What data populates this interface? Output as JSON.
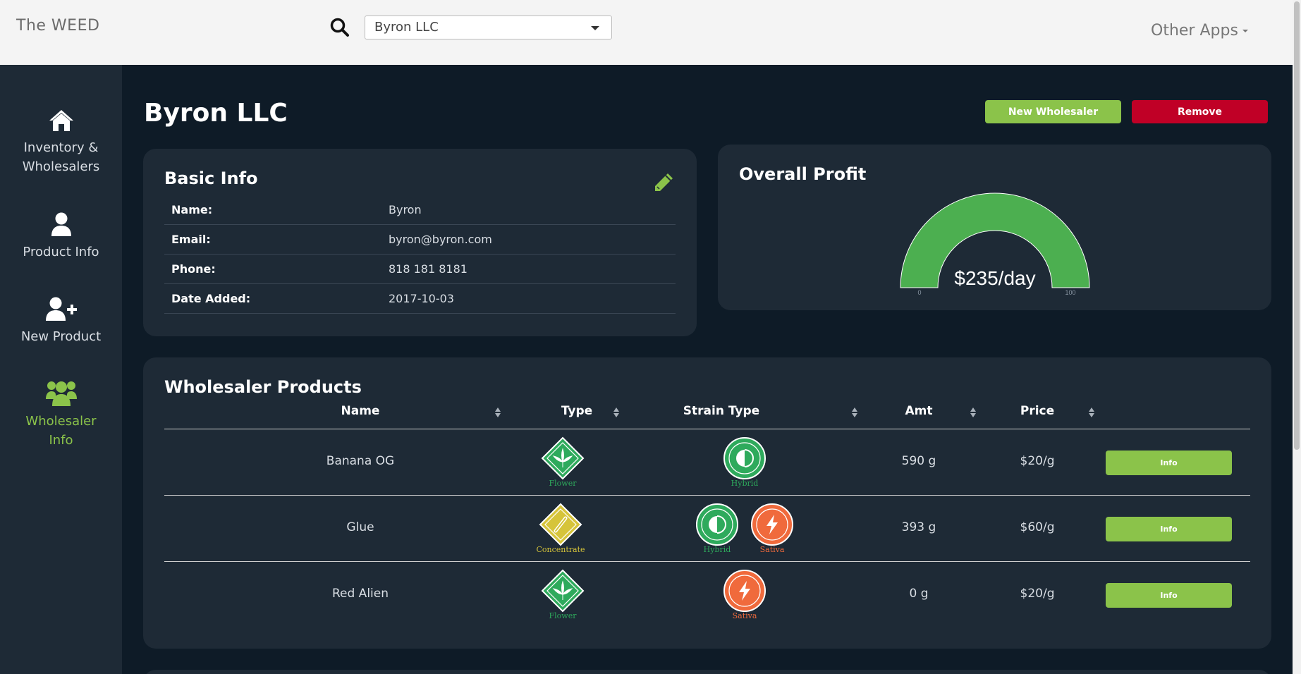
{
  "app": {
    "brand": "The WEED"
  },
  "header": {
    "wholesaler_select": "Byron LLC",
    "other_apps": "Other Apps"
  },
  "sidebar": {
    "items": [
      {
        "label_line1": "Inventory &",
        "label_line2": "Wholesalers",
        "icon": "home-icon",
        "active": false
      },
      {
        "label_line1": "Product Info",
        "label_line2": "",
        "icon": "user-icon",
        "active": false
      },
      {
        "label_line1": "New Product",
        "label_line2": "",
        "icon": "user-plus-icon",
        "active": false
      },
      {
        "label_line1": "Wholesaler",
        "label_line2": "Info",
        "icon": "users-icon",
        "active": true
      }
    ]
  },
  "page": {
    "title": "Byron LLC",
    "new_wholesaler_label": "New Wholesaler",
    "remove_label": "Remove"
  },
  "basic_info": {
    "title": "Basic Info",
    "rows": [
      {
        "key": "Name:",
        "value": "Byron"
      },
      {
        "key": "Email:",
        "value": "byron@byron.com"
      },
      {
        "key": "Phone:",
        "value": "818 181 8181"
      },
      {
        "key": "Date Added:",
        "value": "2017-10-03"
      }
    ]
  },
  "profit": {
    "title": "Overall Profit",
    "value_text": "$235/day",
    "gauge_min": "0",
    "gauge_max": "100",
    "gauge_fill_fraction": 1.0
  },
  "products": {
    "title": "Wholesaler Products",
    "columns": [
      "Name",
      "Type",
      "Strain Type",
      "Amt",
      "Price"
    ],
    "rows": [
      {
        "name": "Banana OG",
        "type": "Flower",
        "strains": [
          "Hybrid"
        ],
        "amt": "590 g",
        "price": "$20/g",
        "action": "Info"
      },
      {
        "name": "Glue",
        "type": "Concentrate",
        "strains": [
          "Hybrid",
          "Sativa"
        ],
        "amt": "393 g",
        "price": "$60/g",
        "action": "Info"
      },
      {
        "name": "Red Alien",
        "type": "Flower",
        "strains": [
          "Sativa"
        ],
        "amt": "0 g",
        "price": "$20/g",
        "action": "Info"
      }
    ]
  },
  "colors": {
    "accent_green": "#8bc34a",
    "danger_red": "#c00026",
    "gauge_green": "#4caf50",
    "flower_green": "#2eaa5c",
    "hybrid_green": "#2eaa5c",
    "sativa_orange": "#f06a3c",
    "concentrate_yellow": "#d6c43a"
  }
}
